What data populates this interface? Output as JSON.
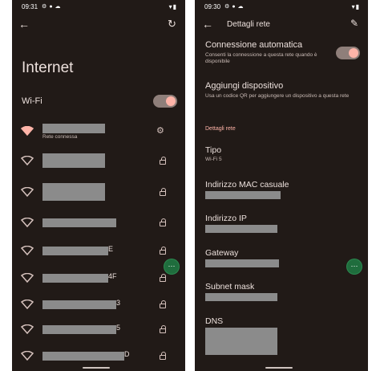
{
  "screen1": {
    "status_time": "09:31",
    "page_title": "Internet",
    "wifi_label": "Wi-Fi",
    "connected_subtitle": "Rete connessa",
    "network_fragments": [
      "",
      "",
      "",
      "",
      "E",
      "4F",
      "3",
      "5",
      "D"
    ]
  },
  "screen2": {
    "status_time": "09:30",
    "header_title": "Dettagli rete",
    "auto_connect": {
      "title": "Connessione automatica",
      "subtitle": "Consenti la connessione a questa rete quando è disponibile"
    },
    "add_device": {
      "title": "Aggiungi dispositivo",
      "subtitle": "Usa un codice QR per aggiungere un dispositivo a questa rete"
    },
    "section_label": "Dettagli rete",
    "details": [
      {
        "label": "Tipo",
        "value": "Wi-Fi 5"
      },
      {
        "label": "Indirizzo MAC casuale",
        "value": ""
      },
      {
        "label": "Indirizzo IP",
        "value": ""
      },
      {
        "label": "Gateway",
        "value": ""
      },
      {
        "label": "Subnet mask",
        "value": ""
      },
      {
        "label": "DNS",
        "value": ""
      }
    ]
  },
  "icons": {
    "back": "arrow-left",
    "refresh": "refresh-arrow",
    "edit": "pencil",
    "settings": "gear",
    "wifi": "wifi-signal",
    "lock": "padlock",
    "fab": "more-dots"
  },
  "colors": {
    "background": "#211a17",
    "accent": "#ffb4a8",
    "fab": "#1f6d3d"
  }
}
